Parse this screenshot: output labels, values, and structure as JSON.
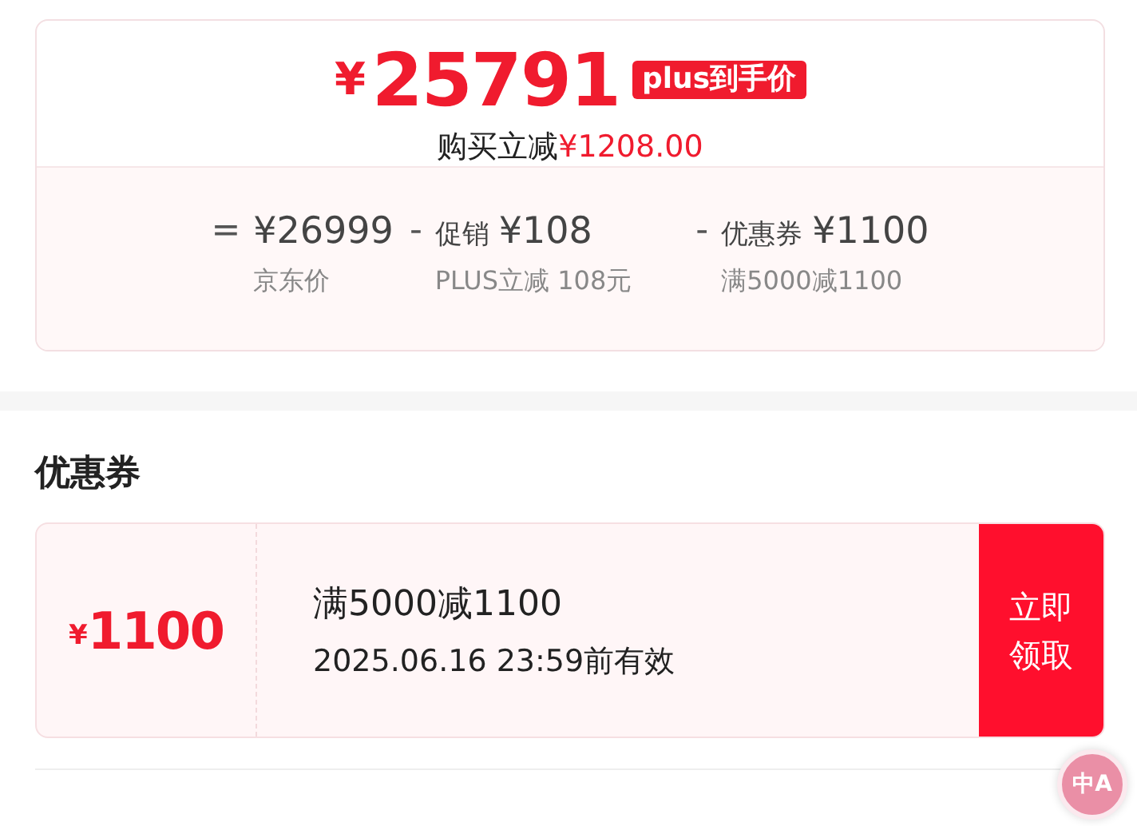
{
  "price_card": {
    "currency": "¥",
    "final_price": "25791",
    "price_tag": "plus到手价",
    "saving_label": "购买立减",
    "saving_amount": "¥1208.00",
    "breakdown": [
      {
        "operator": "=",
        "amount": "¥26999",
        "note": "京东价"
      },
      {
        "operator": "-",
        "name": "促销",
        "amount": "¥108",
        "note": "PLUS立减 108元"
      },
      {
        "operator": "-",
        "name": "优惠券",
        "amount": "¥1100",
        "note": "满5000减1100"
      }
    ]
  },
  "coupons_section": {
    "title": "优惠券",
    "coupons": [
      {
        "currency": "¥",
        "value": "1100",
        "condition": "满5000减1100",
        "validity": "2025.06.16 23:59前有效",
        "button": "立即领取"
      }
    ]
  },
  "translate_button": {
    "label": "中A"
  }
}
